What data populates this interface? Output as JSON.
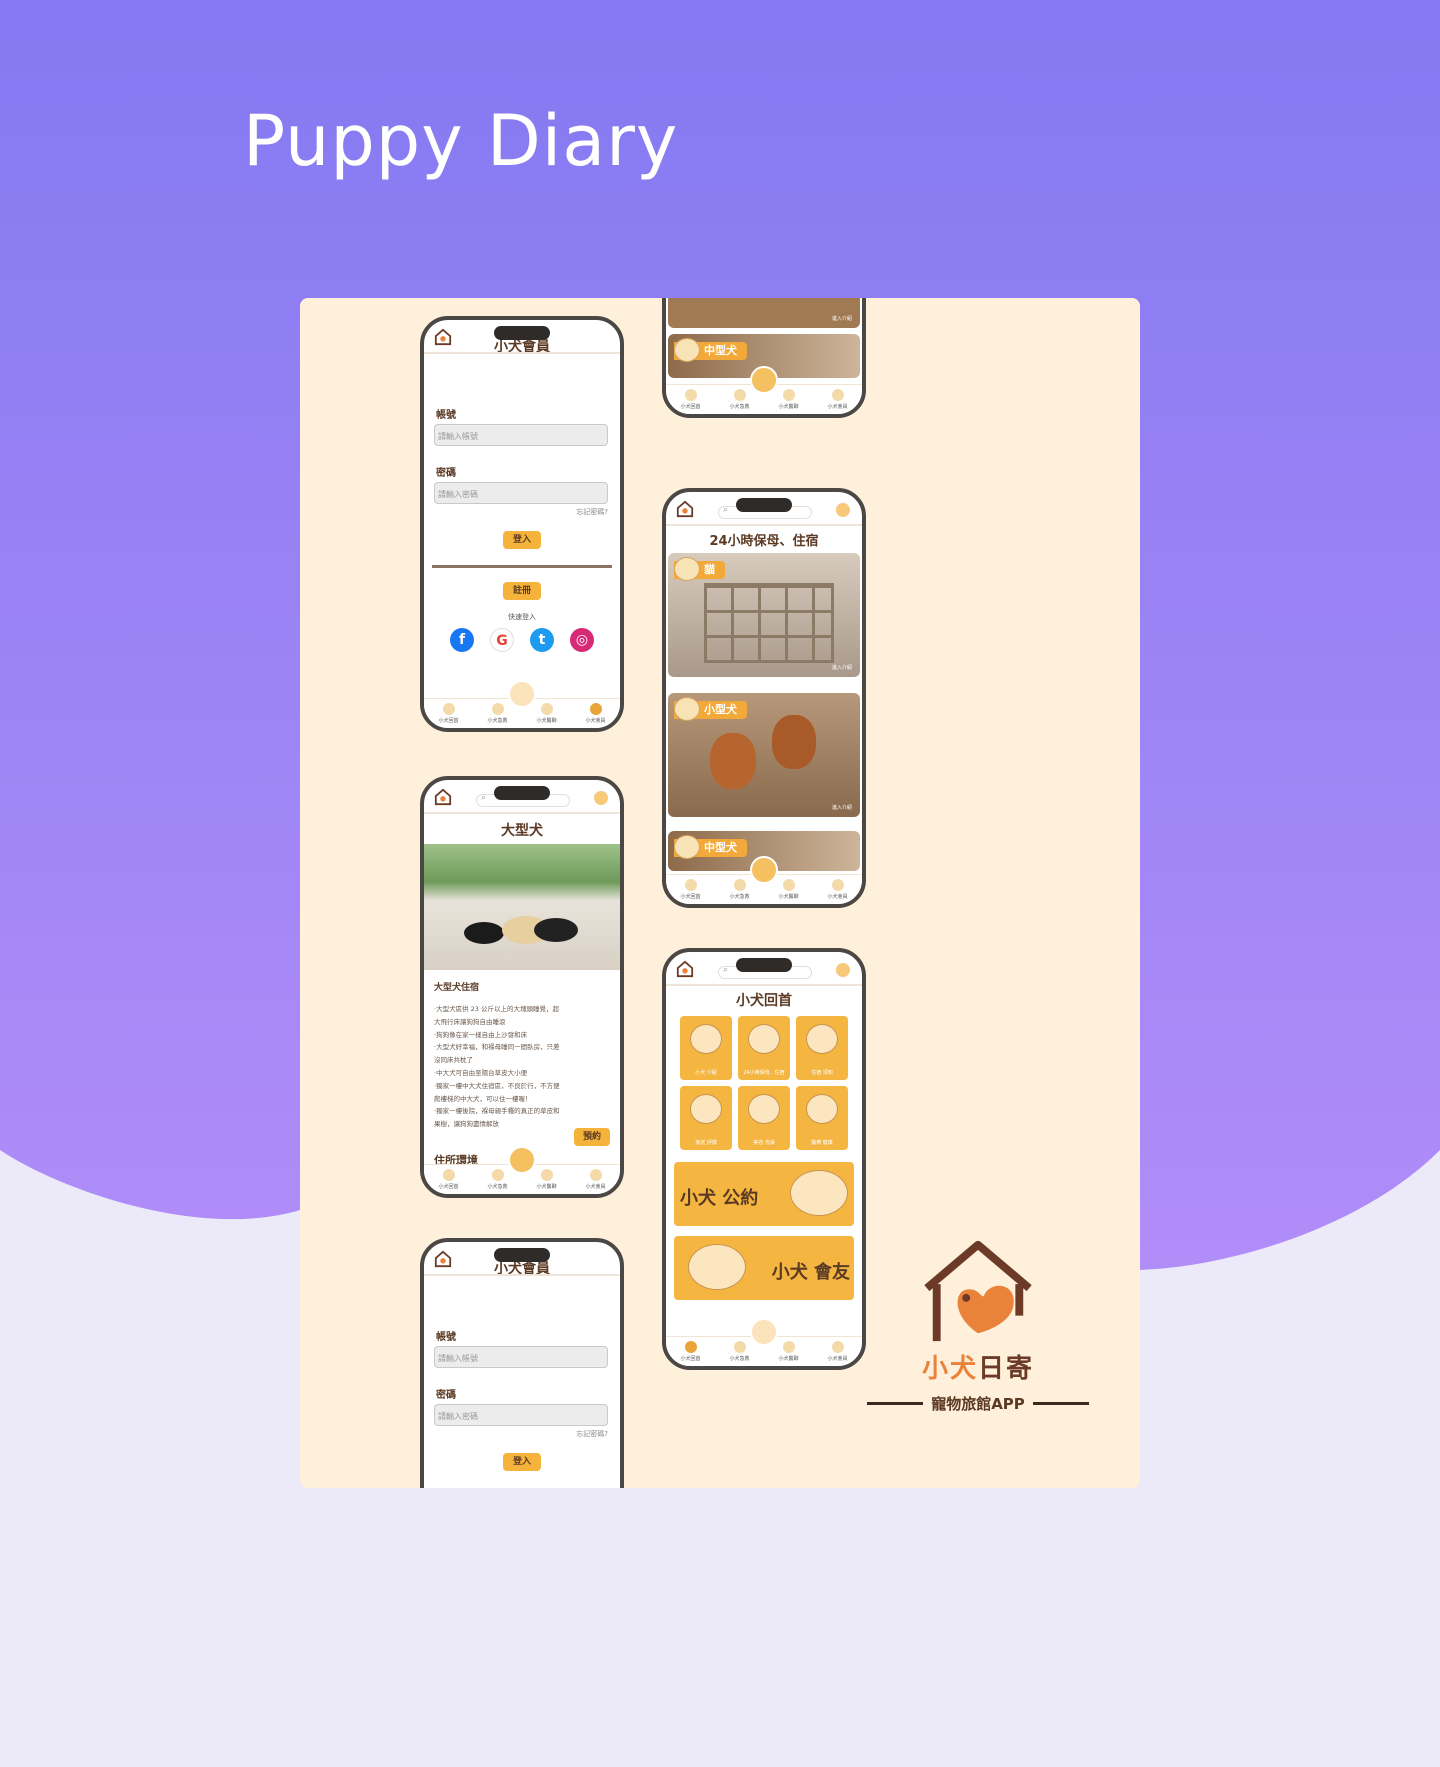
{
  "page": {
    "title": "Puppy Diary",
    "colors": {
      "bg_gradient_top": "#8a80f2",
      "bg_gradient_bottom": "#b08cf7",
      "bg_light": "#ece9f8",
      "card": "#fff0dc",
      "accent": "#f5b33c",
      "brown": "#5b3a24"
    }
  },
  "login": {
    "title": "小犬會員",
    "account_label": "帳號",
    "account_placeholder": "請輸入帳號",
    "password_label": "密碼",
    "password_placeholder": "請輸入密碼",
    "forgot": "忘記密碼?",
    "login_button": "登入",
    "register_button": "註冊",
    "quick_login": "快速登入",
    "socials": [
      {
        "name": "facebook-icon",
        "glyph": "f",
        "color": "#1877f2"
      },
      {
        "name": "google-icon",
        "glyph": "G",
        "color": "#ffffff"
      },
      {
        "name": "twitter-icon",
        "glyph": "t",
        "color": "#1d9bf0"
      },
      {
        "name": "instagram-icon",
        "glyph": "◎",
        "color": "#d62976"
      }
    ]
  },
  "nav": {
    "items": [
      "小犬回首",
      "小犬急救",
      "小犬醫聊",
      "小犬會員"
    ],
    "fab_label": "小犬日寄"
  },
  "large_dog": {
    "title": "大型犬",
    "section_title": "大型犬住宿",
    "lines": [
      "·大型犬區供 23 公斤以上的大塊頭睡覺，超",
      "大飛行床讓狗狗自由睡滾",
      "·狗狗像在家一樣自由上沙發和床",
      "·大型犬好幸福，和褓母睡同一間臥房，只差",
      "沒同床共枕了",
      "·中大犬可自由至陽台草皮大小便",
      "·獨家一樓中大犬住宿區，不良於行，不方便",
      "爬樓梯的中大犬，可以住一樓喔！",
      "·獨家一樓後院，褓母親手種的真正的草皮和",
      "果樹，讓狗狗盡情解放"
    ],
    "reserve_button": "預約",
    "env_title": "住所環境"
  },
  "stay": {
    "header": "24小時保母、住宿",
    "cards": [
      {
        "label": "貓",
        "more": "進入介紹"
      },
      {
        "label": "小型犬",
        "more": "進入介紹"
      },
      {
        "label": "中型犬",
        "more": "進入介紹"
      }
    ],
    "top_card": {
      "label": "中型犬",
      "more": "進入介紹"
    }
  },
  "home": {
    "title": "小犬回首",
    "tiles": [
      {
        "caption": "小犬 介紹"
      },
      {
        "caption": "24小時保母、住宿"
      },
      {
        "caption": "住宿 須知"
      },
      {
        "caption": "接送 評價"
      },
      {
        "caption": "美容 洗澡"
      },
      {
        "caption": "醫療 健康"
      }
    ],
    "banner_rules": "小犬 公約",
    "banner_friends": "小犬 會友"
  },
  "brand": {
    "name_a": "小犬",
    "name_b": "日寄",
    "subtitle": "寵物旅館APP"
  }
}
